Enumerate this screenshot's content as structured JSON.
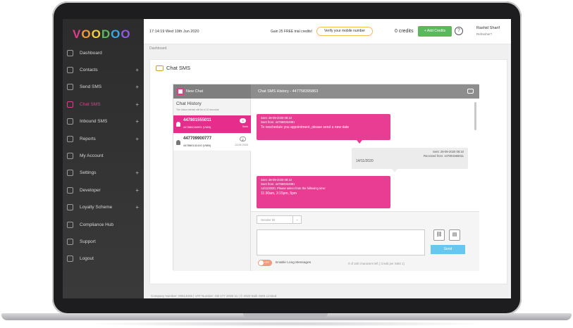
{
  "logo": {
    "text": "VOODOO",
    "colors": [
      "#e23c8a",
      "#f29b3a",
      "#f2d13a",
      "#5cb85c",
      "#3aa8e2",
      "#8e5ce2"
    ]
  },
  "topbar": {
    "datetime": "17:14:19   Wed 10th Jun 2020",
    "promo": "Gain 25 FREE trial credits!",
    "verify": "Verify your mobile number",
    "credits": "0 credits",
    "add_credits": "+ Add Credits",
    "help": "?",
    "user_name": "Rashid Sharif",
    "user_sub": "Refresher?"
  },
  "breadcrumb": "Dashboard",
  "sidebar": {
    "items": [
      {
        "label": "Dashboard",
        "plus": ""
      },
      {
        "label": "Contacts",
        "plus": "+"
      },
      {
        "label": "Send SMS",
        "plus": "+"
      },
      {
        "label": "Chat SMS",
        "plus": "+"
      },
      {
        "label": "Inbound SMS",
        "plus": "+"
      },
      {
        "label": "Reports",
        "plus": "+"
      },
      {
        "label": "My Account",
        "plus": ""
      },
      {
        "label": "Settings",
        "plus": "+"
      },
      {
        "label": "Developer",
        "plus": "+"
      },
      {
        "label": "Loyalty Scheme",
        "plus": "+"
      },
      {
        "label": "Compliance Hub",
        "plus": ""
      },
      {
        "label": "Support",
        "plus": ""
      },
      {
        "label": "Logout",
        "plus": ""
      }
    ]
  },
  "page_title": "Chat SMS",
  "chat": {
    "new_chat": "New Chat",
    "history_header": "Chat SMS History - 447758395863",
    "history_title": "Chat History",
    "history_sub": "The inbox refresh will be in 10 seconds",
    "contacts": [
      {
        "number": "447801555011",
        "sub": "447860034991 (VMN)",
        "badge": "4",
        "when": "5min"
      },
      {
        "number": "447709900777",
        "sub": "447860141410 (VMN)",
        "badge": "2",
        "when": "13.06.2020"
      }
    ],
    "messages": [
      {
        "meta1": "Sent: 28-09-2020 08:10",
        "meta2": "Sent from: 447860034991",
        "text": "To reschedule you appointment, please send a new date"
      },
      {
        "meta1": "Sent: 28-09-2020 08:10",
        "meta2": "Received from: 447801555011",
        "text": "14/11/2020"
      },
      {
        "meta1": "Sent: 28-09-2020 08:10",
        "meta2": "Sent from: 447860034991",
        "text": "14/11/2020, Please select from the following time:",
        "text2": "11:30am, 3:15pm, 5pm"
      }
    ],
    "sender_id": "Sender ID",
    "send": "Send",
    "toggle_off": "OFF",
    "long_messages": "Enable Long Messages",
    "chars_left": "0 of 160 characters left ( Credit per SMS 1)"
  },
  "footer": "Company Number: 09614035 | VAT Number: GB 177 2038 31 | © 2020 Bulk SMS Limited"
}
